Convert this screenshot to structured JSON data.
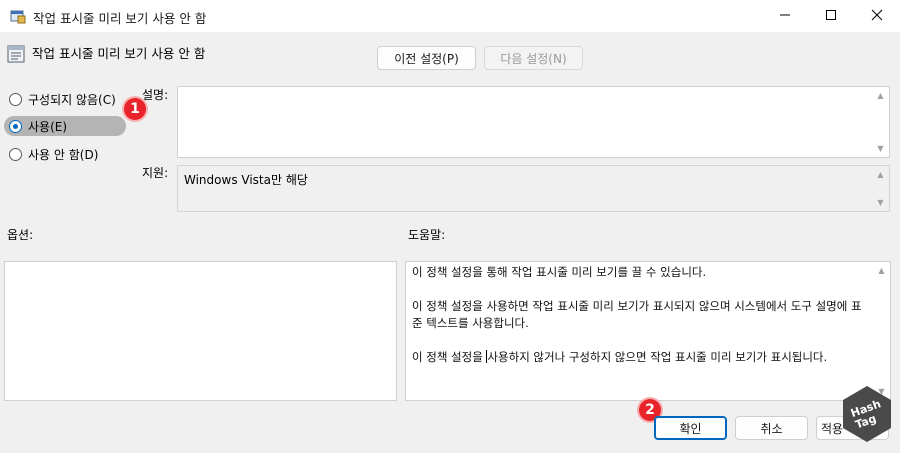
{
  "window": {
    "title": "작업 표시줄 미리 보기 사용 안 함",
    "controls": [
      "minimize-icon",
      "maximize-icon",
      "close-icon"
    ]
  },
  "header": {
    "policy_title": "작업 표시줄 미리 보기 사용 안 함",
    "prev_button": "이전 설정(P)",
    "next_button": "다음 설정(N)"
  },
  "options": {
    "items": [
      {
        "label": "구성되지 않음(C)",
        "checked": false
      },
      {
        "label": "사용(E)",
        "checked": true
      },
      {
        "label": "사용 안 함(D)",
        "checked": false
      }
    ]
  },
  "fields": {
    "description_label": "설명:",
    "description_value": "",
    "supported_label": "지원:",
    "supported_value": "Windows Vista만 해당"
  },
  "sections": {
    "options_label": "옵션:",
    "help_label": "도움말:"
  },
  "help": {
    "p1": "이 정책 설정을 통해 작업 표시줄 미리 보기를 끌 수 있습니다.",
    "p2": "이 정책 설정을 사용하면 작업 표시줄 미리 보기가 표시되지 않으며 시스템에서 도구 설명에 표준 텍스트를 사용합니다.",
    "p3_before": "이 정책 설정을 ",
    "p3_after": "사용하지 않거나 구성하지 않으면 작업 표시줄 미리 보기가 표시됩니다."
  },
  "footer": {
    "ok_button": "확인",
    "cancel_button": "취소",
    "apply_button": "적용"
  },
  "annotations": {
    "badge1": "1",
    "badge2": "2"
  },
  "watermark": {
    "line1": "Hash",
    "line2": "Tag"
  },
  "colors": {
    "accent": "#0067c0",
    "badge": "#e8232a",
    "selection_highlight": "#b4b4b4"
  }
}
